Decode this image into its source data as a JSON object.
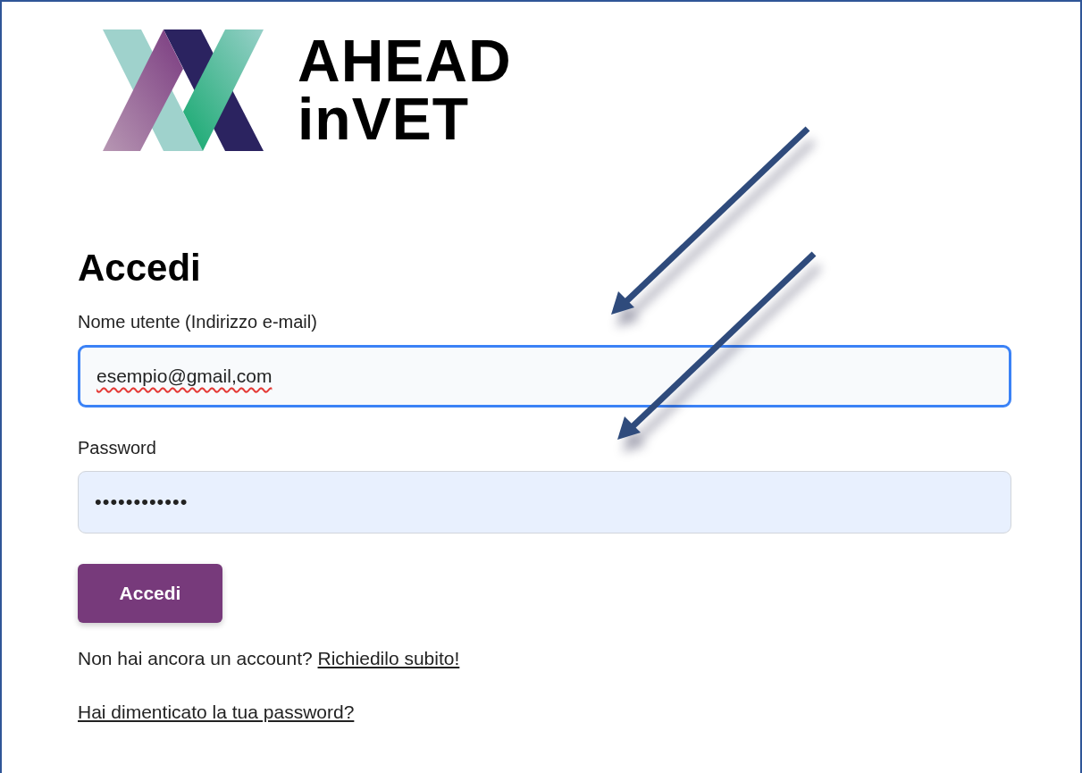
{
  "logo": {
    "lines": [
      "AHEAD",
      "inVET"
    ]
  },
  "heading": "Accedi",
  "fields": [
    {
      "kind": "email",
      "label": "Nome utente (Indirizzo e-mail)",
      "value": "esempio@gmail,com",
      "focused": true,
      "spelling_error": true
    },
    {
      "kind": "password",
      "label": "Password",
      "value": "••••••••••••",
      "focused": false,
      "spelling_error": false
    }
  ],
  "submit_button": "Accedi",
  "signup": {
    "text": "Non hai ancora un account?",
    "link": "Richiedilo subito!"
  },
  "forgot_link": "Hai dimenticato la tua password?"
}
